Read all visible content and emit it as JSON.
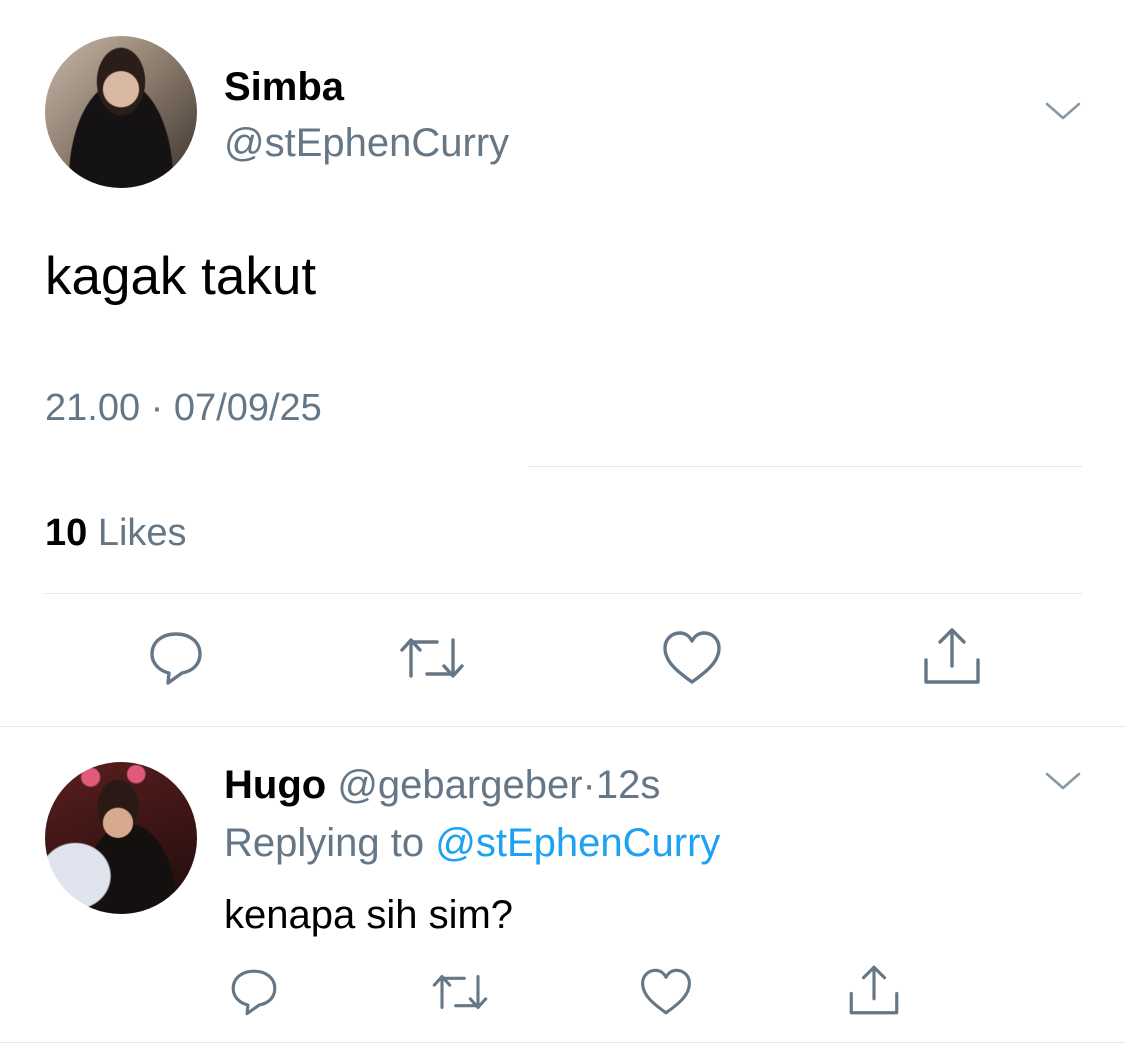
{
  "tweet": {
    "author_name": "Simba",
    "author_handle": "@stEphenCurry",
    "text": "kagak takut",
    "timestamp": "21.00 · 07/09/25",
    "likes_count": "10",
    "likes_label": "Likes",
    "icons": {
      "avatar": "user-avatar",
      "menu": "chevron-down-icon",
      "reply": "reply-icon",
      "retweet": "retweet-icon",
      "like": "heart-icon",
      "share": "share-icon"
    }
  },
  "reply": {
    "author_name": "Hugo",
    "author_handle": "@gebargeber",
    "separator": "·",
    "time": "12s",
    "replying_label": "Replying to",
    "replying_handle": "@stEphenCurry",
    "text": "kenapa sih sim?"
  },
  "colors": {
    "text_primary": "#000000",
    "text_secondary": "#657786",
    "link": "#1da1f2",
    "divider": "#e1e8ed"
  }
}
